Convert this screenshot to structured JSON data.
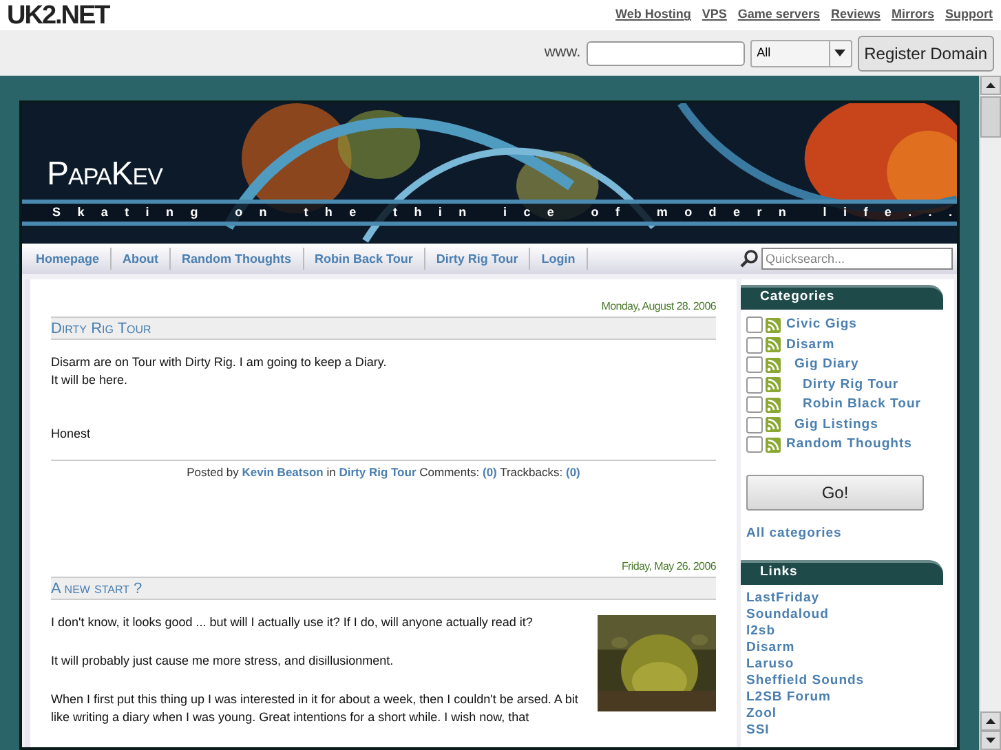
{
  "topbar": {
    "logo": "UK2.NET",
    "links": [
      "Web Hosting",
      "VPS",
      "Game servers",
      "Reviews",
      "Mirrors",
      "Support"
    ]
  },
  "domain_bar": {
    "prefix": "www.",
    "select": "All",
    "button": "Register Domain"
  },
  "blog": {
    "title": "PapaKev",
    "tagline": "Skating on the thin ice of modern life...",
    "nav": [
      {
        "label": "Homepage"
      },
      {
        "label": "About"
      },
      {
        "label": "Random Thoughts"
      },
      {
        "label": "Robin Back Tour"
      },
      {
        "label": "Dirty Rig Tour"
      },
      {
        "label": "Login"
      }
    ],
    "search": {
      "placeholder": "Quicksearch..."
    }
  },
  "posts": [
    {
      "date": "Monday, August 28. 2006",
      "title": "Dirty Rig Tour",
      "paragraphs": [
        "Disarm are on Tour with Dirty Rig. I am going to keep a Diary.\nIt will be here.\n\n\nHonest"
      ],
      "footer": {
        "posted_by": "Posted by",
        "author": "Kevin Beatson",
        "in": "in",
        "category": "Dirty Rig Tour",
        "comments_label": "Comments:",
        "comments": "(0)",
        "trackbacks_label": "Trackbacks:",
        "trackbacks": "(0)"
      }
    },
    {
      "date": "Friday, May 26. 2006",
      "title": "A new start ?",
      "paragraphs": [
        "I don't know, it looks good ... but will I actually use it? If I do, will anyone actually read it?",
        "It will probably just cause me more stress, and disillusionment.",
        "When I first put this thing up I was interested in it for about a week, then I couldn't be arsed. A bit like writing a diary when I was young. Great intentions for a short while. I wish now, that"
      ]
    }
  ],
  "sidebar": {
    "categories": {
      "title": "Categories",
      "items": [
        {
          "label": "Civic Gigs",
          "checked": false
        },
        {
          "label": "Disarm",
          "checked": false,
          "children": [
            {
              "label": "Gig Diary",
              "checked": false,
              "children": [
                {
                  "label": "Dirty Rig Tour",
                  "checked": false
                },
                {
                  "label": "Robin Black Tour",
                  "checked": false
                }
              ]
            },
            {
              "label": "Gig Listings",
              "checked": false
            }
          ]
        },
        {
          "label": "Random Thoughts",
          "checked": false
        }
      ],
      "button": "Go!",
      "all_link": "All categories"
    },
    "links": {
      "title": "Links",
      "items": [
        "LastFriday",
        "Soundaloud",
        "l2sb",
        "Disarm",
        "Laruso",
        "Sheffield Sounds",
        "L2SB Forum",
        "Zool",
        "SSI"
      ]
    }
  }
}
